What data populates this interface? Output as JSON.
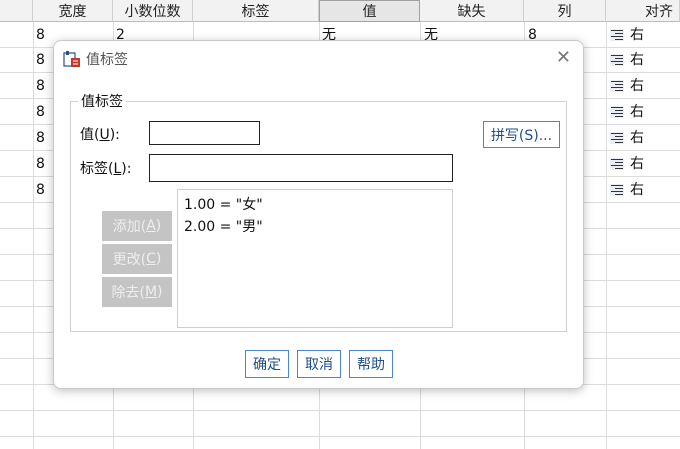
{
  "grid": {
    "headers": [
      "",
      "宽度",
      "小数位数",
      "标签",
      "值",
      "缺失",
      "列",
      "对齐"
    ],
    "row1": {
      "width": "8",
      "decimals": "2",
      "value": "无",
      "missing": "无",
      "columns": "8",
      "align": "右"
    },
    "widths": [
      "8",
      "8",
      "8",
      "8",
      "8",
      "8"
    ],
    "align": [
      "右",
      "右",
      "右",
      "右",
      "右",
      "右"
    ]
  },
  "dialog": {
    "title": "值标签",
    "group_title": "值标签",
    "value_label_text": "值(",
    "value_label_key": "U",
    "value_label_tail": "):",
    "label_label_text": "标签(",
    "label_label_key": "L",
    "label_label_tail": "):",
    "value_input": "",
    "label_input": "",
    "spell_button": "拼写(S)...",
    "add_text": "添加(",
    "add_key": "A",
    "change_text": "更改(",
    "change_key": "C",
    "remove_text": "除去(",
    "remove_key": "M",
    "items": [
      "1.00 = \"女\"",
      "2.00 = \"男\""
    ],
    "ok": "确定",
    "cancel": "取消",
    "help": "帮助"
  },
  "icons": {
    "title": "value-label-icon",
    "close": "close-icon",
    "align": "align-right-icon"
  }
}
